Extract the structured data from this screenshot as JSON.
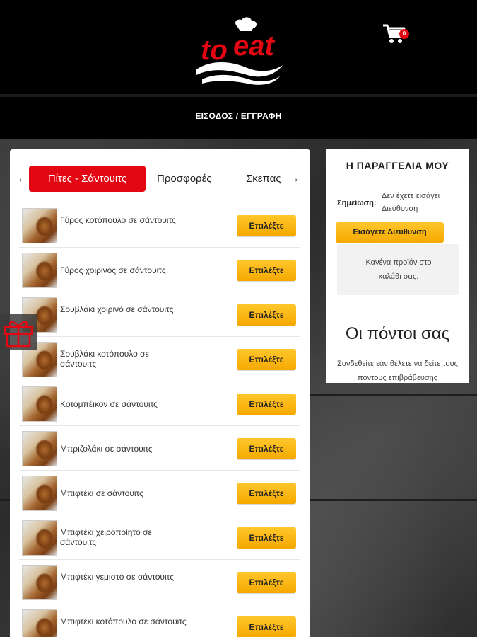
{
  "header": {
    "logo_text": "to eat",
    "cart_count": "0",
    "login_label": "ΕΙΣΟΔΟΣ / ΕΓΓΡΑΦΗ"
  },
  "categories": {
    "active": "Πίτες - Σάντουιτς",
    "tabs": [
      "Προσφορές",
      "Σκεπας"
    ]
  },
  "products": [
    {
      "name": "Γύρος κοτόπουλο σε σάντουιτς",
      "button": "Επιλέξτε"
    },
    {
      "name": "Γύρος χοιρινός σε σάντουιτς",
      "button": "Επιλέξτε"
    },
    {
      "name": "Σουβλάκι χοιρινό σε σάντουιτς",
      "button": "Επιλέξτε"
    },
    {
      "name": "Σουβλάκι κοτόπουλο σε σάντουιτς",
      "button": "Επιλέξτε"
    },
    {
      "name": "Κοτομπέικον σε σάντουιτς",
      "button": "Επιλέξτε"
    },
    {
      "name": "Μπριζολάκι σε σάντουιτς",
      "button": "Επιλέξτε"
    },
    {
      "name": "Μπιφτέκι σε σάντουιτς",
      "button": "Επιλέξτε"
    },
    {
      "name": "Μπιφτέκι χειροποίητο σε σάντουιτς",
      "button": "Επιλέξτε"
    },
    {
      "name": "Μπιφτέκι γεμιστό σε σάντουιτς",
      "button": "Επιλέξτε"
    },
    {
      "name": "Μπιφτέκι κοτόπουλο σε σάντουιτς",
      "button": "Επιλέξτε"
    }
  ],
  "order": {
    "title": "Η ΠΑΡΑΓΓΕΛΙΑ ΜΟΥ",
    "note_label": "Σημείωση:",
    "note_text": "Δεν έχετε εισάγει Διεύθυνση",
    "address_button": "Εισάγετε Διεύθυνση",
    "empty_cart": "Κανένα προϊόν στο καλάθι σας."
  },
  "points": {
    "title": "Οι πόντοι σας",
    "text": "Συνδεθείτε εάν θέλετε να δείτε τους πόντους επιβράβευσης"
  },
  "colors": {
    "brand_red": "#e30613",
    "button_yellow": "#f5a800",
    "header_bg": "#000000"
  }
}
